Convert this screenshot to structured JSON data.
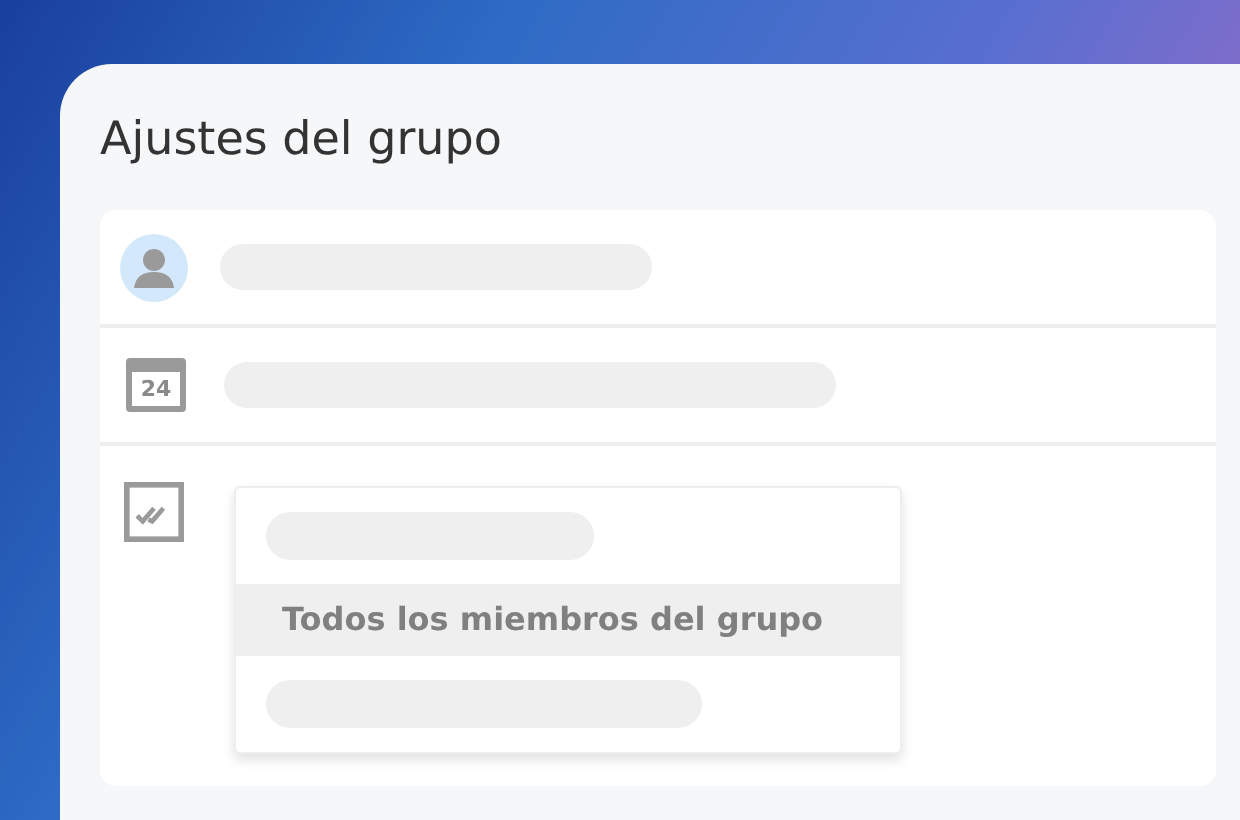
{
  "panel": {
    "title": "Ajustes del grupo"
  },
  "rows": [
    {
      "kind": "avatar"
    },
    {
      "kind": "calendar",
      "day": "24"
    },
    {
      "kind": "select",
      "options": [
        {
          "kind": "skeleton",
          "selected": false
        },
        {
          "kind": "text",
          "label": "Todos los miembros del grupo",
          "selected": true
        },
        {
          "kind": "skeleton",
          "selected": false
        }
      ]
    }
  ]
}
